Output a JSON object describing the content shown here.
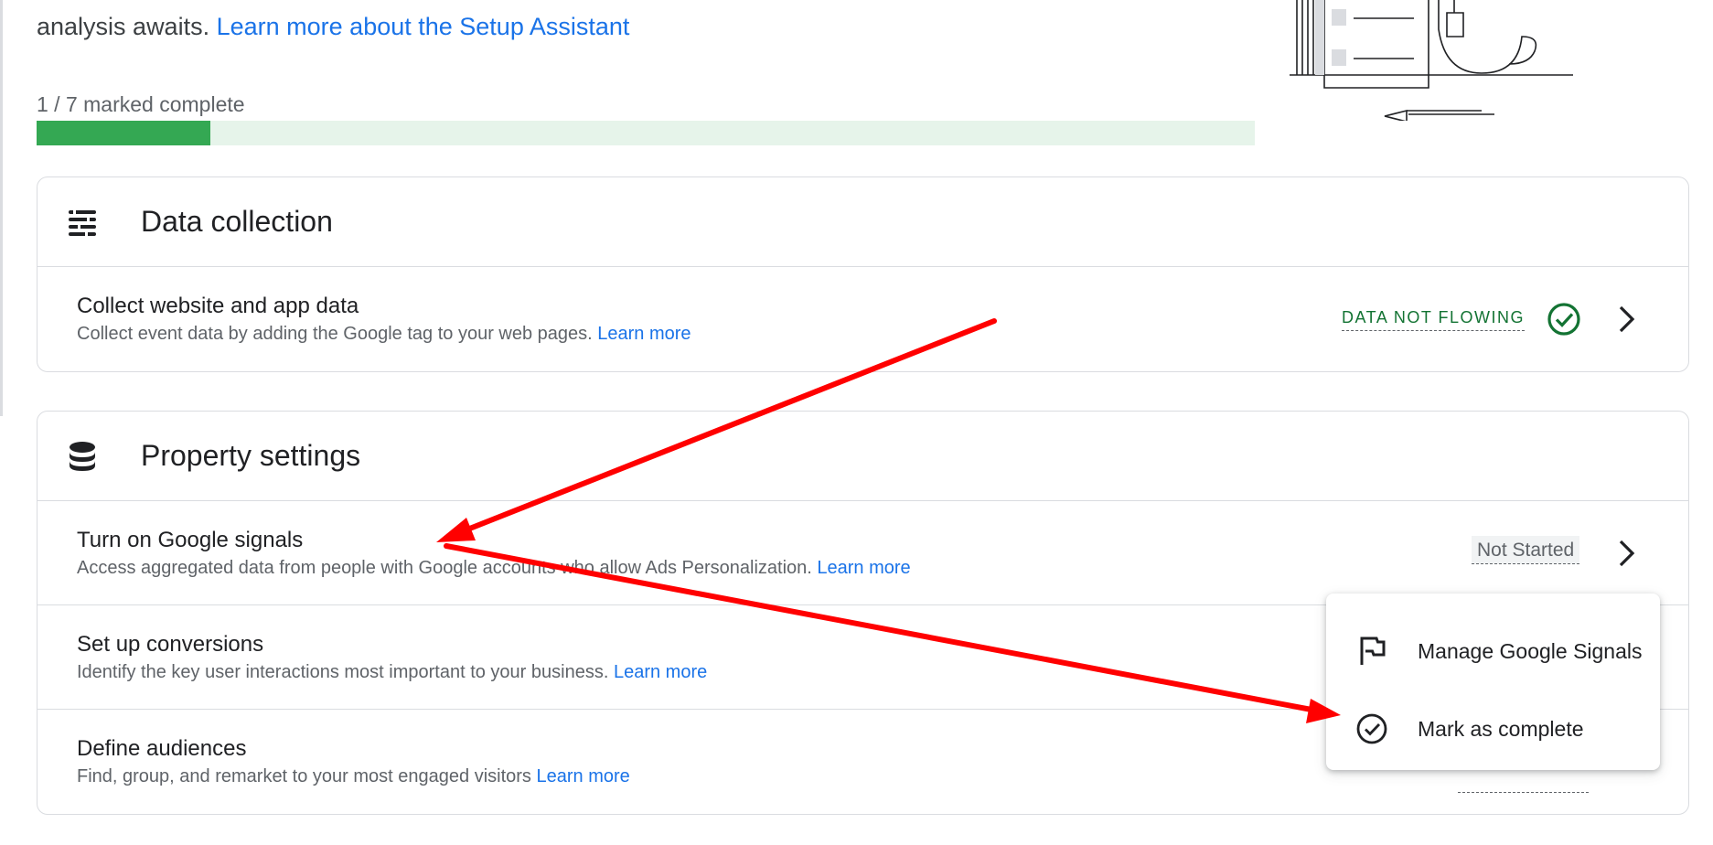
{
  "intro": {
    "text": "analysis awaits.",
    "link": "Learn more about the Setup Assistant"
  },
  "progress": {
    "label": "1 / 7 marked complete",
    "completed": 1,
    "total": 7
  },
  "sections": {
    "data_collection": {
      "title": "Data collection",
      "icon": "tune-icon",
      "items": [
        {
          "title": "Collect website and app data",
          "description": "Collect event data by adding the Google tag to your web pages.",
          "link": "Learn more",
          "status": "DATA NOT FLOWING"
        }
      ]
    },
    "property_settings": {
      "title": "Property settings",
      "icon": "database-icon",
      "items": [
        {
          "title": "Turn on Google signals",
          "description": "Access aggregated data from people with Google accounts who allow Ads Personalization.",
          "link": "Learn more",
          "status": "Not Started"
        },
        {
          "title": "Set up conversions",
          "description": "Identify the key user interactions most important to your business.",
          "link": "Learn more"
        },
        {
          "title": "Define audiences",
          "description": "Find, group, and remarket to your most engaged visitors",
          "link": "Learn more"
        }
      ]
    }
  },
  "context_menu": {
    "items": [
      {
        "label": "Manage Google Signals",
        "icon": "flag-icon"
      },
      {
        "label": "Mark as complete",
        "icon": "check-circle-icon"
      }
    ]
  },
  "colors": {
    "accent": "#1a73e8",
    "progress_fill": "#34a853",
    "progress_track": "#e6f4ea",
    "status_green": "#137333",
    "annotation_arrow": "#ff0000"
  }
}
